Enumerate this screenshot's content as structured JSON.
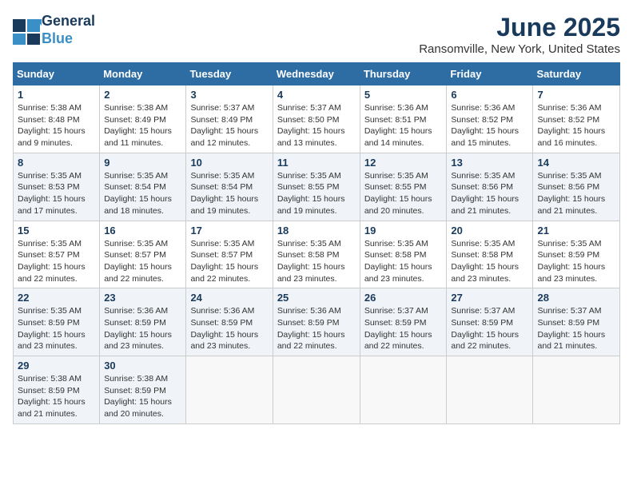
{
  "logo": {
    "line1": "General",
    "line2": "Blue"
  },
  "title": "June 2025",
  "location": "Ransomville, New York, United States",
  "days_of_week": [
    "Sunday",
    "Monday",
    "Tuesday",
    "Wednesday",
    "Thursday",
    "Friday",
    "Saturday"
  ],
  "weeks": [
    [
      {
        "day": "1",
        "sunrise": "5:38 AM",
        "sunset": "8:48 PM",
        "daylight": "15 hours and 9 minutes."
      },
      {
        "day": "2",
        "sunrise": "5:38 AM",
        "sunset": "8:49 PM",
        "daylight": "15 hours and 11 minutes."
      },
      {
        "day": "3",
        "sunrise": "5:37 AM",
        "sunset": "8:49 PM",
        "daylight": "15 hours and 12 minutes."
      },
      {
        "day": "4",
        "sunrise": "5:37 AM",
        "sunset": "8:50 PM",
        "daylight": "15 hours and 13 minutes."
      },
      {
        "day": "5",
        "sunrise": "5:36 AM",
        "sunset": "8:51 PM",
        "daylight": "15 hours and 14 minutes."
      },
      {
        "day": "6",
        "sunrise": "5:36 AM",
        "sunset": "8:52 PM",
        "daylight": "15 hours and 15 minutes."
      },
      {
        "day": "7",
        "sunrise": "5:36 AM",
        "sunset": "8:52 PM",
        "daylight": "15 hours and 16 minutes."
      }
    ],
    [
      {
        "day": "8",
        "sunrise": "5:35 AM",
        "sunset": "8:53 PM",
        "daylight": "15 hours and 17 minutes."
      },
      {
        "day": "9",
        "sunrise": "5:35 AM",
        "sunset": "8:54 PM",
        "daylight": "15 hours and 18 minutes."
      },
      {
        "day": "10",
        "sunrise": "5:35 AM",
        "sunset": "8:54 PM",
        "daylight": "15 hours and 19 minutes."
      },
      {
        "day": "11",
        "sunrise": "5:35 AM",
        "sunset": "8:55 PM",
        "daylight": "15 hours and 19 minutes."
      },
      {
        "day": "12",
        "sunrise": "5:35 AM",
        "sunset": "8:55 PM",
        "daylight": "15 hours and 20 minutes."
      },
      {
        "day": "13",
        "sunrise": "5:35 AM",
        "sunset": "8:56 PM",
        "daylight": "15 hours and 21 minutes."
      },
      {
        "day": "14",
        "sunrise": "5:35 AM",
        "sunset": "8:56 PM",
        "daylight": "15 hours and 21 minutes."
      }
    ],
    [
      {
        "day": "15",
        "sunrise": "5:35 AM",
        "sunset": "8:57 PM",
        "daylight": "15 hours and 22 minutes."
      },
      {
        "day": "16",
        "sunrise": "5:35 AM",
        "sunset": "8:57 PM",
        "daylight": "15 hours and 22 minutes."
      },
      {
        "day": "17",
        "sunrise": "5:35 AM",
        "sunset": "8:57 PM",
        "daylight": "15 hours and 22 minutes."
      },
      {
        "day": "18",
        "sunrise": "5:35 AM",
        "sunset": "8:58 PM",
        "daylight": "15 hours and 23 minutes."
      },
      {
        "day": "19",
        "sunrise": "5:35 AM",
        "sunset": "8:58 PM",
        "daylight": "15 hours and 23 minutes."
      },
      {
        "day": "20",
        "sunrise": "5:35 AM",
        "sunset": "8:58 PM",
        "daylight": "15 hours and 23 minutes."
      },
      {
        "day": "21",
        "sunrise": "5:35 AM",
        "sunset": "8:59 PM",
        "daylight": "15 hours and 23 minutes."
      }
    ],
    [
      {
        "day": "22",
        "sunrise": "5:35 AM",
        "sunset": "8:59 PM",
        "daylight": "15 hours and 23 minutes."
      },
      {
        "day": "23",
        "sunrise": "5:36 AM",
        "sunset": "8:59 PM",
        "daylight": "15 hours and 23 minutes."
      },
      {
        "day": "24",
        "sunrise": "5:36 AM",
        "sunset": "8:59 PM",
        "daylight": "15 hours and 23 minutes."
      },
      {
        "day": "25",
        "sunrise": "5:36 AM",
        "sunset": "8:59 PM",
        "daylight": "15 hours and 22 minutes."
      },
      {
        "day": "26",
        "sunrise": "5:37 AM",
        "sunset": "8:59 PM",
        "daylight": "15 hours and 22 minutes."
      },
      {
        "day": "27",
        "sunrise": "5:37 AM",
        "sunset": "8:59 PM",
        "daylight": "15 hours and 22 minutes."
      },
      {
        "day": "28",
        "sunrise": "5:37 AM",
        "sunset": "8:59 PM",
        "daylight": "15 hours and 21 minutes."
      }
    ],
    [
      {
        "day": "29",
        "sunrise": "5:38 AM",
        "sunset": "8:59 PM",
        "daylight": "15 hours and 21 minutes."
      },
      {
        "day": "30",
        "sunrise": "5:38 AM",
        "sunset": "8:59 PM",
        "daylight": "15 hours and 20 minutes."
      },
      null,
      null,
      null,
      null,
      null
    ]
  ]
}
